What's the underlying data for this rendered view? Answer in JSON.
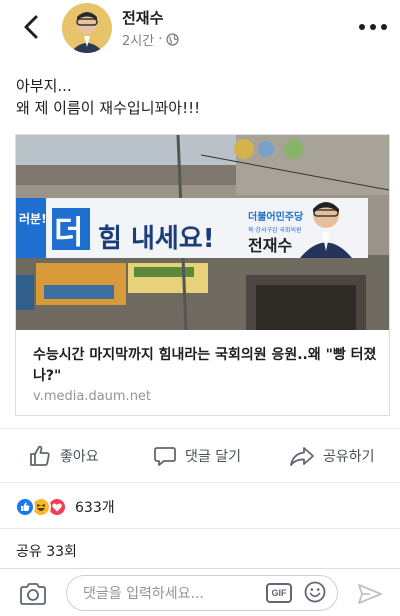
{
  "header": {
    "author": "전재수",
    "time": "2시간",
    "privacy_icon": "globe-icon"
  },
  "post": {
    "text_line1": "아부지...",
    "text_line2": "왜 제 이름이 재수입니꽈아!!!"
  },
  "link": {
    "banner_text_left": "러분!",
    "banner_text_main": "지더힘 내세요!",
    "banner_party": "더불어민주당",
    "banner_name": "전재수",
    "title": "수능시간 마지막까지 힘내라는 국회의원 응원..왜 \"빵 터졌나?\"",
    "domain": "v.media.daum.net"
  },
  "actions": {
    "like": "좋아요",
    "comment": "댓글 달기",
    "share": "공유하기"
  },
  "reactions": {
    "icons": [
      "like-icon",
      "haha-icon",
      "love-icon"
    ],
    "count": "633개"
  },
  "shares": "공유 33회",
  "comment_bar": {
    "placeholder": "댓글을 입력하세요...",
    "gif_label": "GIF"
  },
  "colors": {
    "like_blue": "#1877f2",
    "haha_yellow": "#f7b928",
    "love_red": "#f33e58",
    "icon_gray": "#606770"
  }
}
